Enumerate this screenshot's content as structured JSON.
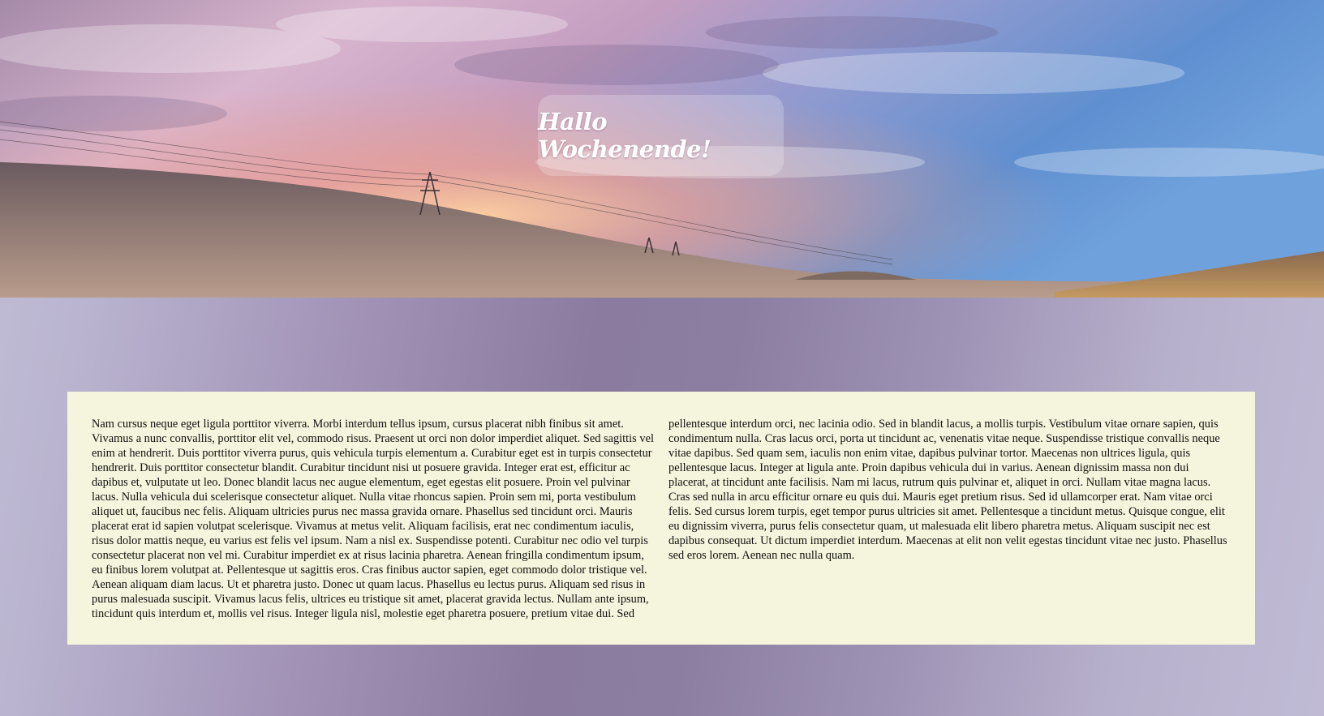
{
  "header": {
    "title": "Hallo Wochenende!"
  },
  "colors": {
    "content_background": "#f5f4dc",
    "title_text": "#ffffff",
    "page_gradient_mid": "#8b7c9f"
  },
  "content": {
    "text": "Nam cursus neque eget ligula porttitor viverra. Morbi interdum tellus ipsum, cursus placerat nibh finibus sit amet. Vivamus a nunc convallis, porttitor elit vel, commodo risus. Praesent ut orci non dolor imperdiet aliquet. Sed sagittis vel enim at hendrerit. Duis porttitor viverra purus, quis vehicula turpis elementum a. Curabitur eget est in turpis consectetur hendrerit. Duis porttitor consectetur blandit. Curabitur tincidunt nisi ut posuere gravida. Integer erat est, efficitur ac dapibus et, vulputate ut leo. Donec blandit lacus nec augue elementum, eget egestas elit posuere. Proin vel pulvinar lacus. Nulla vehicula dui scelerisque consectetur aliquet. Nulla vitae rhoncus sapien. Proin sem mi, porta vestibulum aliquet ut, faucibus nec felis. Aliquam ultricies purus nec massa gravida ornare. Phasellus sed tincidunt orci. Mauris placerat erat id sapien volutpat scelerisque. Vivamus at metus velit. Aliquam facilisis, erat nec condimentum iaculis, risus dolor mattis neque, eu varius est felis vel ipsum. Nam a nisl ex. Suspendisse potenti. Curabitur nec odio vel turpis consectetur placerat non vel mi. Curabitur imperdiet ex at risus lacinia pharetra. Aenean fringilla condimentum ipsum, eu finibus lorem volutpat at. Pellentesque ut sagittis eros. Cras finibus auctor sapien, eget commodo dolor tristique vel. Aenean aliquam diam lacus. Ut et pharetra justo. Donec ut quam lacus. Phasellus eu lectus purus. Aliquam sed risus in purus malesuada suscipit. Vivamus lacus felis, ultrices eu tristique sit amet, placerat gravida lectus. Nullam ante ipsum, tincidunt quis interdum et, mollis vel risus. Integer ligula nisl, molestie eget pharetra posuere, pretium vitae dui. Sed pellentesque interdum orci, nec lacinia odio. Sed in blandit lacus, a mollis turpis. Vestibulum vitae ornare sapien, quis condimentum nulla. Cras lacus orci, porta ut tincidunt ac, venenatis vitae neque. Suspendisse tristique convallis neque vitae dapibus. Sed quam sem, iaculis non enim vitae, dapibus pulvinar tortor. Maecenas non ultrices ligula, quis pellentesque lacus. Integer at ligula ante. Proin dapibus vehicula dui in varius. Aenean dignissim massa non dui placerat, at tincidunt ante facilisis. Nam mi lacus, rutrum quis pulvinar et, aliquet in orci. Nullam vitae magna lacus. Cras sed nulla in arcu efficitur ornare eu quis dui. Mauris eget pretium risus. Sed id ullamcorper erat. Nam vitae orci felis. Sed cursus lorem turpis, eget tempor purus ultricies sit amet. Pellentesque a tincidunt metus. Quisque congue, elit eu dignissim viverra, purus felis consectetur quam, ut malesuada elit libero pharetra metus. Aliquam suscipit nec est dapibus consequat. Ut dictum imperdiet interdum. Maecenas at elit non velit egestas tincidunt vitae nec justo. Phasellus sed eros lorem. Aenean nec nulla quam."
  }
}
